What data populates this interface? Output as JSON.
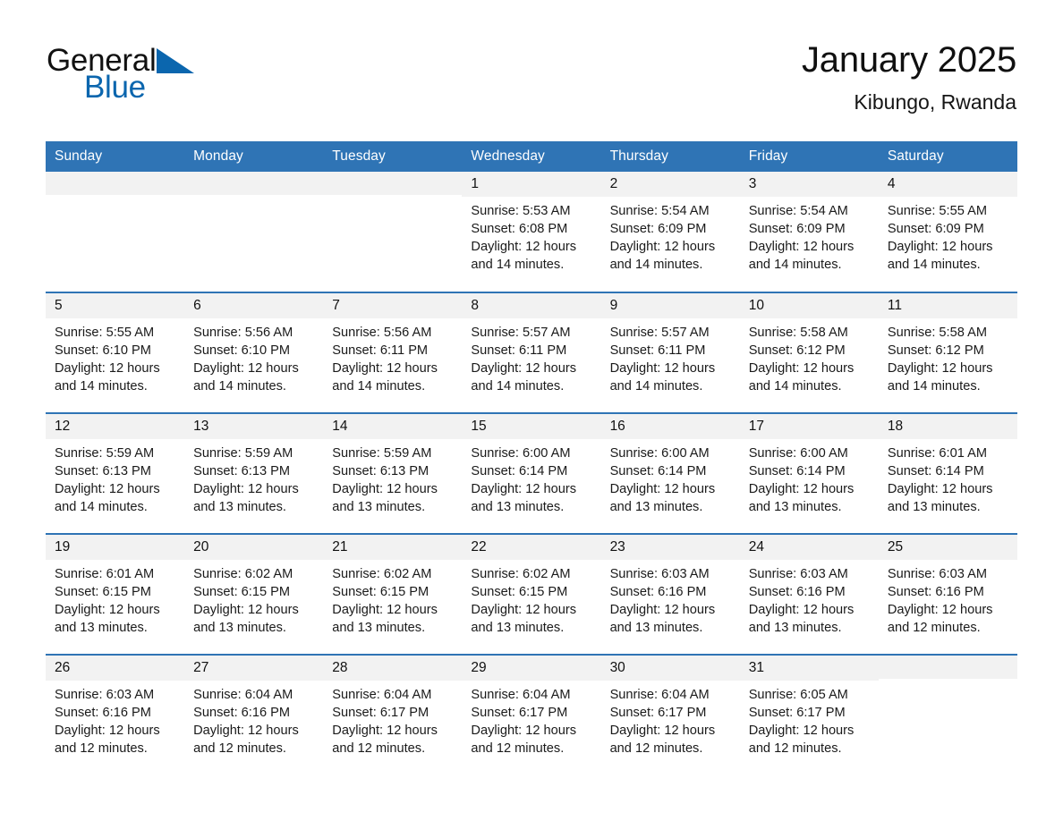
{
  "brand": {
    "word1": "General",
    "word2": "Blue",
    "triangle_color": "#0b66ae",
    "text_color": "#111111"
  },
  "header": {
    "title": "January 2025",
    "location": "Kibungo, Rwanda"
  },
  "theme": {
    "header_blue": "#2f74b5",
    "row_divider_blue": "#2f74b5",
    "daynum_band": "#f2f2f2",
    "page_background": "#ffffff"
  },
  "weekday_headers": [
    "Sunday",
    "Monday",
    "Tuesday",
    "Wednesday",
    "Thursday",
    "Friday",
    "Saturday"
  ],
  "labels": {
    "sunrise_prefix": "Sunrise:",
    "sunset_prefix": "Sunset:",
    "daylight_prefix": "Daylight:"
  },
  "weeks": [
    [
      {
        "day": "",
        "empty": true
      },
      {
        "day": "",
        "empty": true
      },
      {
        "day": "",
        "empty": true
      },
      {
        "day": "1",
        "sunrise": "Sunrise: 5:53 AM",
        "sunset": "Sunset: 6:08 PM",
        "daylight": "Daylight: 12 hours and 14 minutes."
      },
      {
        "day": "2",
        "sunrise": "Sunrise: 5:54 AM",
        "sunset": "Sunset: 6:09 PM",
        "daylight": "Daylight: 12 hours and 14 minutes."
      },
      {
        "day": "3",
        "sunrise": "Sunrise: 5:54 AM",
        "sunset": "Sunset: 6:09 PM",
        "daylight": "Daylight: 12 hours and 14 minutes."
      },
      {
        "day": "4",
        "sunrise": "Sunrise: 5:55 AM",
        "sunset": "Sunset: 6:09 PM",
        "daylight": "Daylight: 12 hours and 14 minutes."
      }
    ],
    [
      {
        "day": "5",
        "sunrise": "Sunrise: 5:55 AM",
        "sunset": "Sunset: 6:10 PM",
        "daylight": "Daylight: 12 hours and 14 minutes."
      },
      {
        "day": "6",
        "sunrise": "Sunrise: 5:56 AM",
        "sunset": "Sunset: 6:10 PM",
        "daylight": "Daylight: 12 hours and 14 minutes."
      },
      {
        "day": "7",
        "sunrise": "Sunrise: 5:56 AM",
        "sunset": "Sunset: 6:11 PM",
        "daylight": "Daylight: 12 hours and 14 minutes."
      },
      {
        "day": "8",
        "sunrise": "Sunrise: 5:57 AM",
        "sunset": "Sunset: 6:11 PM",
        "daylight": "Daylight: 12 hours and 14 minutes."
      },
      {
        "day": "9",
        "sunrise": "Sunrise: 5:57 AM",
        "sunset": "Sunset: 6:11 PM",
        "daylight": "Daylight: 12 hours and 14 minutes."
      },
      {
        "day": "10",
        "sunrise": "Sunrise: 5:58 AM",
        "sunset": "Sunset: 6:12 PM",
        "daylight": "Daylight: 12 hours and 14 minutes."
      },
      {
        "day": "11",
        "sunrise": "Sunrise: 5:58 AM",
        "sunset": "Sunset: 6:12 PM",
        "daylight": "Daylight: 12 hours and 14 minutes."
      }
    ],
    [
      {
        "day": "12",
        "sunrise": "Sunrise: 5:59 AM",
        "sunset": "Sunset: 6:13 PM",
        "daylight": "Daylight: 12 hours and 14 minutes."
      },
      {
        "day": "13",
        "sunrise": "Sunrise: 5:59 AM",
        "sunset": "Sunset: 6:13 PM",
        "daylight": "Daylight: 12 hours and 13 minutes."
      },
      {
        "day": "14",
        "sunrise": "Sunrise: 5:59 AM",
        "sunset": "Sunset: 6:13 PM",
        "daylight": "Daylight: 12 hours and 13 minutes."
      },
      {
        "day": "15",
        "sunrise": "Sunrise: 6:00 AM",
        "sunset": "Sunset: 6:14 PM",
        "daylight": "Daylight: 12 hours and 13 minutes."
      },
      {
        "day": "16",
        "sunrise": "Sunrise: 6:00 AM",
        "sunset": "Sunset: 6:14 PM",
        "daylight": "Daylight: 12 hours and 13 minutes."
      },
      {
        "day": "17",
        "sunrise": "Sunrise: 6:00 AM",
        "sunset": "Sunset: 6:14 PM",
        "daylight": "Daylight: 12 hours and 13 minutes."
      },
      {
        "day": "18",
        "sunrise": "Sunrise: 6:01 AM",
        "sunset": "Sunset: 6:14 PM",
        "daylight": "Daylight: 12 hours and 13 minutes."
      }
    ],
    [
      {
        "day": "19",
        "sunrise": "Sunrise: 6:01 AM",
        "sunset": "Sunset: 6:15 PM",
        "daylight": "Daylight: 12 hours and 13 minutes."
      },
      {
        "day": "20",
        "sunrise": "Sunrise: 6:02 AM",
        "sunset": "Sunset: 6:15 PM",
        "daylight": "Daylight: 12 hours and 13 minutes."
      },
      {
        "day": "21",
        "sunrise": "Sunrise: 6:02 AM",
        "sunset": "Sunset: 6:15 PM",
        "daylight": "Daylight: 12 hours and 13 minutes."
      },
      {
        "day": "22",
        "sunrise": "Sunrise: 6:02 AM",
        "sunset": "Sunset: 6:15 PM",
        "daylight": "Daylight: 12 hours and 13 minutes."
      },
      {
        "day": "23",
        "sunrise": "Sunrise: 6:03 AM",
        "sunset": "Sunset: 6:16 PM",
        "daylight": "Daylight: 12 hours and 13 minutes."
      },
      {
        "day": "24",
        "sunrise": "Sunrise: 6:03 AM",
        "sunset": "Sunset: 6:16 PM",
        "daylight": "Daylight: 12 hours and 13 minutes."
      },
      {
        "day": "25",
        "sunrise": "Sunrise: 6:03 AM",
        "sunset": "Sunset: 6:16 PM",
        "daylight": "Daylight: 12 hours and 12 minutes."
      }
    ],
    [
      {
        "day": "26",
        "sunrise": "Sunrise: 6:03 AM",
        "sunset": "Sunset: 6:16 PM",
        "daylight": "Daylight: 12 hours and 12 minutes."
      },
      {
        "day": "27",
        "sunrise": "Sunrise: 6:04 AM",
        "sunset": "Sunset: 6:16 PM",
        "daylight": "Daylight: 12 hours and 12 minutes."
      },
      {
        "day": "28",
        "sunrise": "Sunrise: 6:04 AM",
        "sunset": "Sunset: 6:17 PM",
        "daylight": "Daylight: 12 hours and 12 minutes."
      },
      {
        "day": "29",
        "sunrise": "Sunrise: 6:04 AM",
        "sunset": "Sunset: 6:17 PM",
        "daylight": "Daylight: 12 hours and 12 minutes."
      },
      {
        "day": "30",
        "sunrise": "Sunrise: 6:04 AM",
        "sunset": "Sunset: 6:17 PM",
        "daylight": "Daylight: 12 hours and 12 minutes."
      },
      {
        "day": "31",
        "sunrise": "Sunrise: 6:05 AM",
        "sunset": "Sunset: 6:17 PM",
        "daylight": "Daylight: 12 hours and 12 minutes."
      },
      {
        "day": "",
        "empty": true
      }
    ]
  ]
}
